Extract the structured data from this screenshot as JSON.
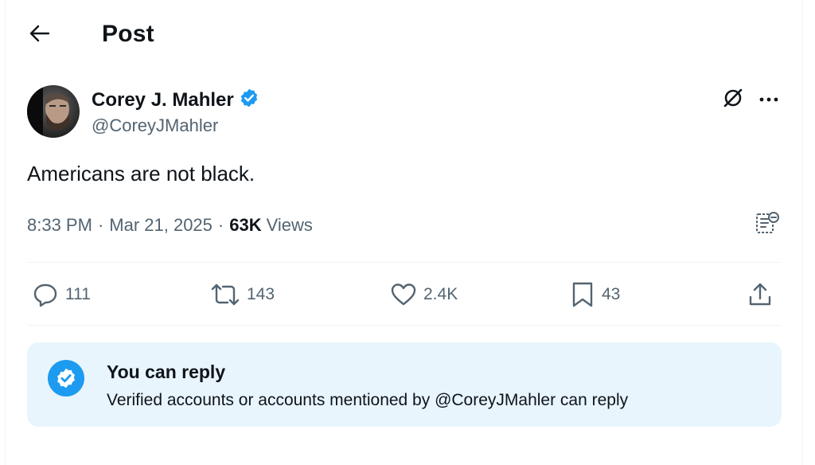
{
  "header": {
    "title": "Post"
  },
  "author": {
    "display_name": "Corey J. Mahler",
    "handle": "@CoreyJMahler",
    "verified": true
  },
  "post": {
    "text": "Americans are not black.",
    "time": "8:33 PM",
    "date": "Mar 21, 2025",
    "views_count": "63K",
    "views_label": "Views"
  },
  "actions": {
    "replies": "111",
    "reposts": "143",
    "likes": "2.4K",
    "bookmarks": "43"
  },
  "reply_notice": {
    "title": "You can reply",
    "subtitle": "Verified accounts or accounts mentioned by @CoreyJMahler can reply"
  },
  "colors": {
    "accent": "#1d9bf0",
    "text_primary": "#0f1419",
    "text_secondary": "#536471",
    "notice_background": "#e8f5fd",
    "divider": "#eff3f4"
  },
  "icons": {
    "back": "arrow-left-icon",
    "verified": "verified-badge-icon",
    "grok": "grok-icon",
    "more": "more-horizontal-icon",
    "analytics": "post-analytics-icon",
    "reply": "reply-bubble-icon",
    "repost": "repost-icon",
    "like": "heart-icon",
    "bookmark": "bookmark-icon",
    "share": "share-icon"
  }
}
